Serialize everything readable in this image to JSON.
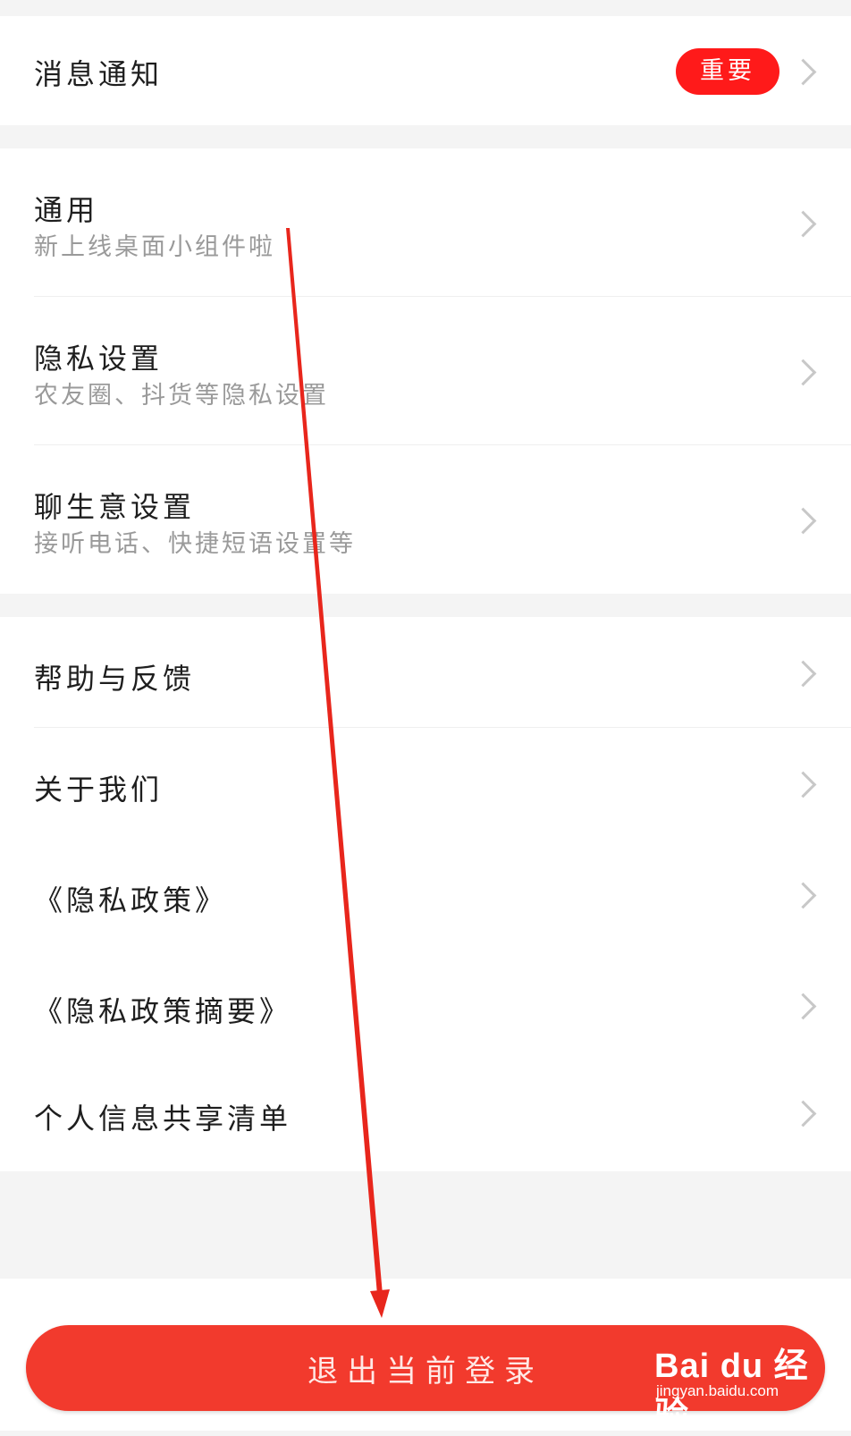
{
  "notifications": {
    "title": "消息通知",
    "badge": "重要"
  },
  "group1": [
    {
      "title": "通用",
      "subtitle": "新上线桌面小组件啦"
    },
    {
      "title": "隐私设置",
      "subtitle": "农友圈、抖货等隐私设置"
    },
    {
      "title": "聊生意设置",
      "subtitle": "接听电话、快捷短语设置等"
    }
  ],
  "group2": [
    {
      "title": "帮助与反馈"
    },
    {
      "title": "关于我们"
    },
    {
      "title": "《隐私政策》"
    },
    {
      "title": "《隐私政策摘要》"
    },
    {
      "title": "个人信息共享清单"
    }
  ],
  "logout": {
    "label": "退出当前登录"
  },
  "watermark": {
    "brand": "Bai du 经验",
    "url": "jingyan.baidu.com"
  },
  "colors": {
    "accent": "#f23a2d",
    "badge": "#ff1a1a",
    "annotation_arrow": "#e8261c"
  },
  "icons": {
    "row_arrow": "chevron-right-icon"
  }
}
